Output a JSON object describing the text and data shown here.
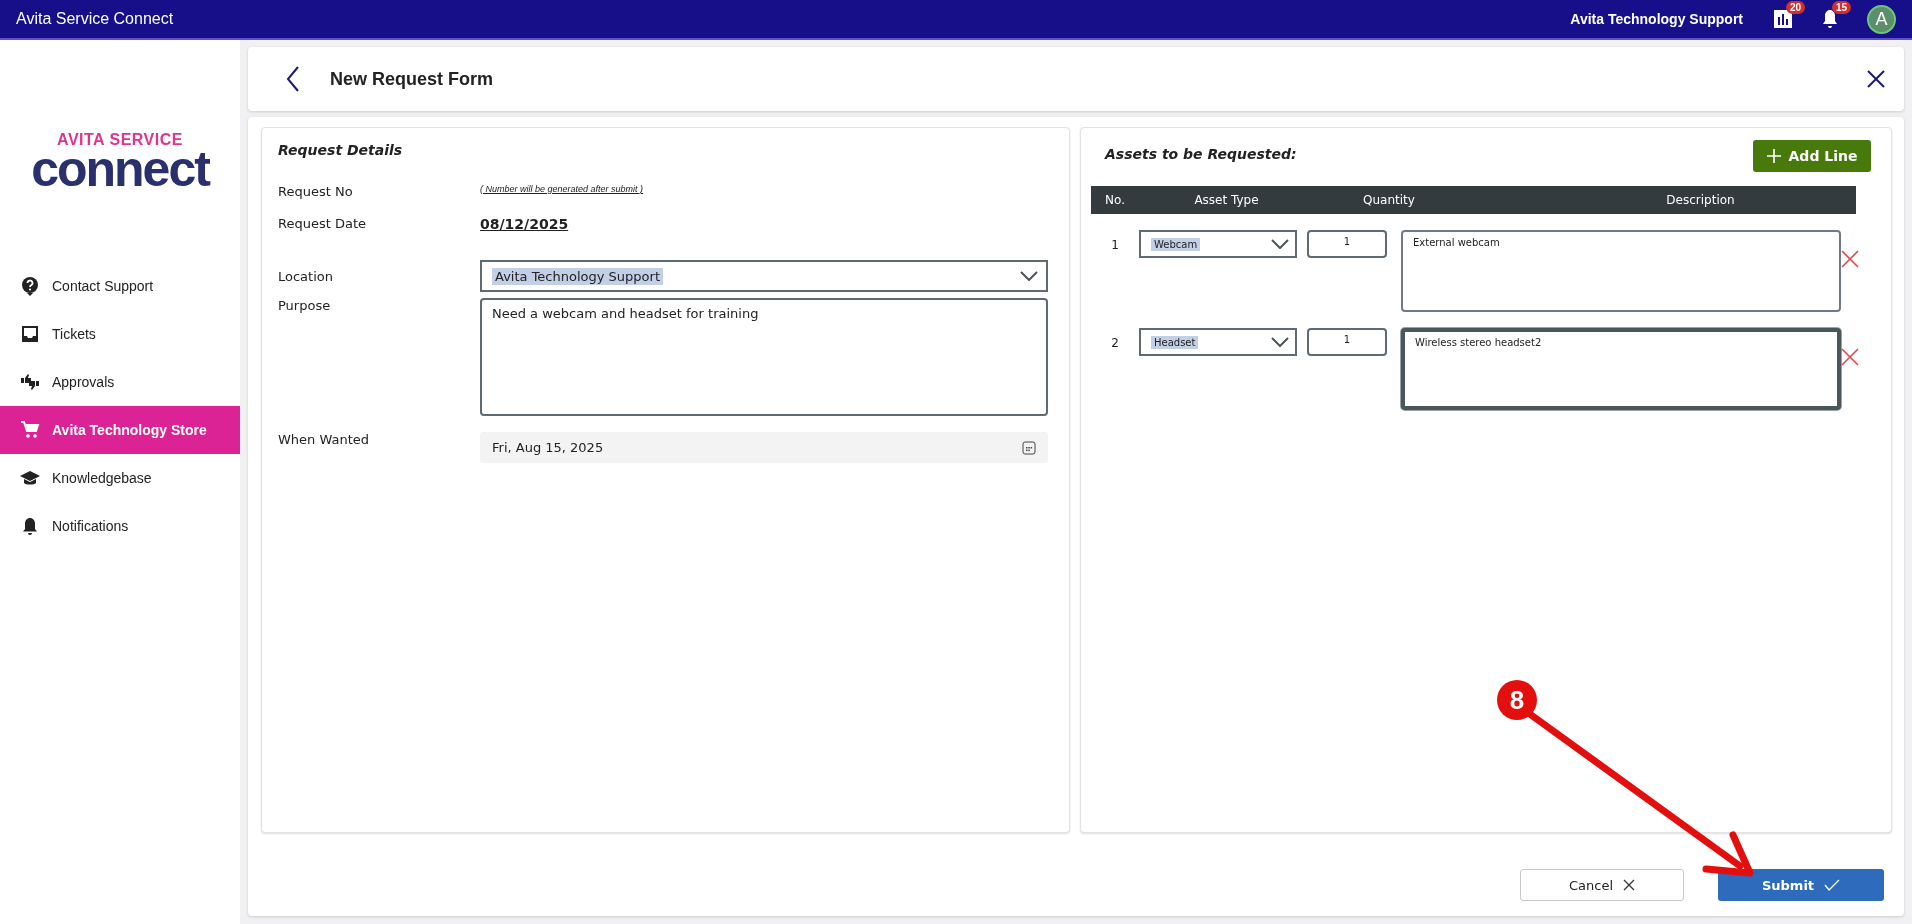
{
  "app_bar": {
    "title": "Avita Service Connect",
    "user_name": "Avita Technology Support",
    "reports_badge": "20",
    "notifications_badge": "15",
    "avatar_initial": "A"
  },
  "logo": {
    "top": "AVITA SERVICE",
    "bottom": "connect"
  },
  "sidebar": {
    "items": [
      {
        "label": "Contact Support",
        "selected": false
      },
      {
        "label": "Tickets",
        "selected": false
      },
      {
        "label": "Approvals",
        "selected": false
      },
      {
        "label": "Avita Technology Store",
        "selected": true
      },
      {
        "label": "Knowledgebase",
        "selected": false
      },
      {
        "label": "Notifications",
        "selected": false
      }
    ]
  },
  "header": {
    "title": "New Request Form"
  },
  "request_details": {
    "title": "Request Details",
    "fields": [
      {
        "kind": "note",
        "label": "Request No",
        "value": "( Number will be generated after submit )"
      },
      {
        "kind": "date_text",
        "label": "Request Date",
        "value": "08/12/2025"
      },
      {
        "kind": "dropdown",
        "label": "Location",
        "value": "Avita Technology Support",
        "text_selected": true
      },
      {
        "kind": "textarea",
        "label": "Purpose",
        "value": "Need a webcam and headset for training"
      },
      {
        "kind": "datepicker",
        "label": "When Wanted",
        "value": "Fri, Aug 15, 2025"
      }
    ]
  },
  "assets": {
    "title": "Assets to be Requested:",
    "add_button": "Add Line",
    "columns": [
      "No.",
      "Asset Type",
      "Quantity",
      "Description"
    ],
    "rows": [
      {
        "no": "1",
        "asset_type": "Webcam",
        "type_selected": true,
        "quantity": "1",
        "description": "External webcam",
        "focused": false
      },
      {
        "no": "2",
        "asset_type": "Headset",
        "type_selected": true,
        "quantity": "1",
        "description": "Wireless stereo headset2",
        "focused": true
      }
    ]
  },
  "buttons": {
    "cancel": "Cancel",
    "submit": "Submit"
  },
  "annotation": {
    "step": "8"
  }
}
